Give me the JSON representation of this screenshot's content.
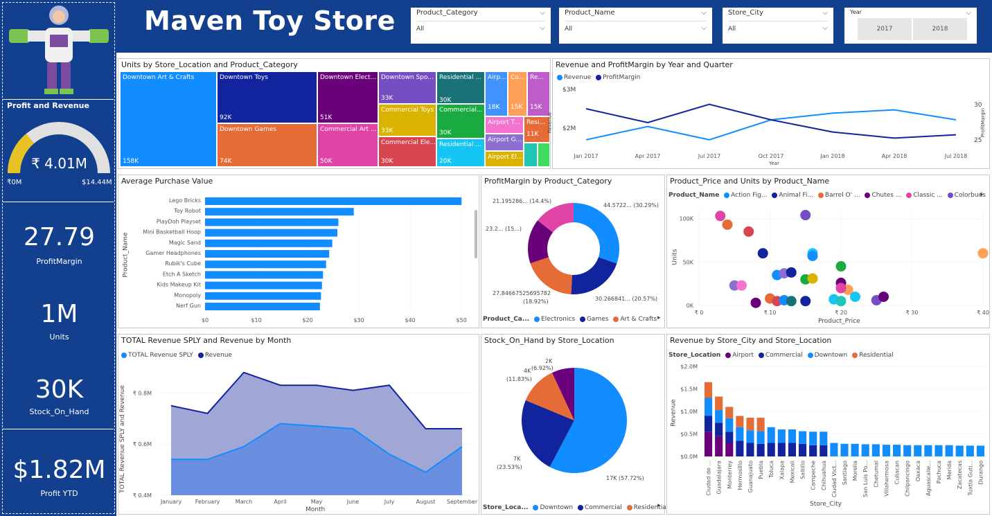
{
  "header": {
    "title": "Maven Toy Store"
  },
  "slicers": [
    {
      "label": "Product_Category",
      "value": "All"
    },
    {
      "label": "Product_Name",
      "value": "All"
    },
    {
      "label": "Store_City",
      "value": "All"
    }
  ],
  "year_slicer": {
    "label": "Year",
    "options": [
      "2017",
      "2018"
    ]
  },
  "left": {
    "gauge": {
      "title": "Profit and Revenue",
      "value": "₹ 4.01M",
      "min": "₹0M",
      "max": "$14.44M",
      "fraction": 0.28
    },
    "kpis": [
      {
        "value": "27.79",
        "label": "ProfitMargin"
      },
      {
        "value": "1M",
        "label": "Units"
      },
      {
        "value": "30K",
        "label": "Stock_On_Hand"
      },
      {
        "value": "$1.82M",
        "label": "Profit YTD"
      }
    ]
  },
  "colors": {
    "navy": "#133f8f",
    "blue": "#118dff",
    "darkblue": "#12239e",
    "orange": "#e66c37",
    "purple": "#6b007b",
    "pink": "#e044a7",
    "gold": "#e8c125"
  },
  "treemap": {
    "title": "Units by Store_Location and Product_Category",
    "cells": [
      {
        "label": "Downtown Art & Crafts",
        "value": "158K",
        "color": "#118dff"
      },
      {
        "label": "Downtown Toys",
        "value": "92K",
        "color": "#12239e"
      },
      {
        "label": "Downtown Games",
        "value": "74K",
        "color": "#e66c37"
      },
      {
        "label": "Downtown Elect...",
        "value": "51K",
        "color": "#6b007b"
      },
      {
        "label": "Commercial Art ...",
        "value": "50K",
        "color": "#e044a7"
      },
      {
        "label": "Downtown Spo...",
        "value": "33K",
        "color": "#744ec2"
      },
      {
        "label": "Commercial Toys",
        "value": "33K",
        "color": "#d9b300"
      },
      {
        "label": "Commercial Ele...",
        "value": "30K",
        "color": "#d64550"
      },
      {
        "label": "Residential ...",
        "value": "30K",
        "color": "#197278"
      },
      {
        "label": "Commercial...",
        "value": "30K",
        "color": "#1aab40"
      },
      {
        "label": "Residential ...",
        "value": "20K",
        "color": "#15c6f4"
      },
      {
        "label": "Airp...",
        "value": "18K",
        "color": "#4092ff"
      },
      {
        "label": "Co...",
        "value": "15K",
        "color": "#ffa058"
      },
      {
        "label": "Re...",
        "value": "15K",
        "color": "#be5dc9"
      },
      {
        "label": "Airport T...",
        "value": "",
        "color": "#f472d0"
      },
      {
        "label": "Resi...",
        "value": "11K",
        "color": "#e66c37"
      },
      {
        "label": "Airport G...",
        "value": "",
        "color": "#8d6fd1"
      },
      {
        "label": "Airport El...",
        "value": "",
        "color": "#d9b300"
      },
      {
        "label": "",
        "value": "",
        "color": "#1fc6b5"
      },
      {
        "label": "",
        "value": "",
        "color": "#3ddc5f"
      }
    ]
  },
  "line_chart": {
    "title": "Revenue and ProfitMargin by Year and Quarter",
    "legend": [
      "Revenue",
      "ProfitMargin"
    ],
    "ylabel_left": "Revenue",
    "ylabel_right": "ProfitMargin",
    "xlabel": "Year",
    "left_ticks": [
      "$3M",
      "$2M"
    ],
    "right_ticks": [
      "30",
      "25"
    ]
  },
  "bar_chart": {
    "title": "Average Purchase Value",
    "ylabel": "Product_Name",
    "x_ticks": [
      "$0",
      "$10",
      "$20",
      "$30",
      "$40",
      "$50"
    ]
  },
  "donut": {
    "title": "ProfitMargin by Product_Category",
    "labels": [
      "21.195286... (14.4%)",
      "44.5722... (30.29%)",
      "23.2... (15...)",
      "27.84667525695782",
      "(18.92%)",
      "30.266841... (20.57%)"
    ],
    "legend_title": "Product_Ca...",
    "legend": [
      "Electronics",
      "Games",
      "Art & Crafts"
    ]
  },
  "scatter": {
    "title": "Product_Price and Units by Product_Name",
    "legend_title": "Product_Name",
    "legend": [
      "Action Fig...",
      "Animal Fi...",
      "Barrel O' ...",
      "Chutes ...",
      "Classic ...",
      "Colorbuds"
    ],
    "xlabel": "Product_Price",
    "ylabel": "Units",
    "x_ticks": [
      "₹ 0",
      "₹ 10",
      "₹ 20",
      "₹ 30",
      "₹ 40"
    ],
    "y_ticks": [
      "100K",
      "50K",
      "0K"
    ]
  },
  "area_chart": {
    "title": "TOTAL Revenue SPLY and Revenue by Month",
    "legend": [
      "TOTAL Revenue SPLY",
      "Revenue"
    ],
    "ylabel": "TOTAL Revenue SPLY and Revenue",
    "xlabel": "Month",
    "y_ticks": [
      "₹ 0.8M",
      "₹ 0.6M",
      "₹ 0.4M"
    ]
  },
  "pie": {
    "title": "Stock_On_Hand by Store_Location",
    "labels": [
      "2K",
      "(6.92%)",
      "4K",
      "(11.83%)",
      "7K",
      "(23.53%)",
      "17K (57.72%)"
    ],
    "legend_title": "Store_Loca...",
    "legend": [
      "Downtown",
      "Commercial",
      "Residential"
    ]
  },
  "stacked": {
    "title": "Revenue by Store_City and Store_Location",
    "legend_title": "Store_Location",
    "legend": [
      "Airport",
      "Commercial",
      "Downtown",
      "Residential"
    ],
    "ylabel": "Revenue",
    "xlabel": "Store_City",
    "y_ticks": [
      "$2.0M",
      "$1.5M",
      "$1.0M",
      "$0.5M",
      "$0.0M"
    ]
  },
  "chart_data": [
    {
      "type": "line",
      "title": "Revenue and ProfitMargin by Year and Quarter",
      "x": [
        "Jan 2017",
        "Apr 2017",
        "Jul 2017",
        "Oct 2017",
        "Jan 2018",
        "Apr 2018",
        "Jul 2018"
      ],
      "series": [
        {
          "name": "Revenue",
          "values": [
            1.6,
            2.0,
            1.6,
            2.2,
            2.4,
            2.5,
            2.2
          ],
          "axis": "left",
          "ylim": [
            1.2,
            3.2
          ]
        },
        {
          "name": "ProfitMargin",
          "values": [
            30.0,
            27.5,
            30.8,
            28.0,
            25.8,
            24.7,
            25.3
          ],
          "axis": "right",
          "ylim": [
            22,
            34
          ]
        }
      ]
    },
    {
      "type": "bar",
      "title": "Average Purchase Value",
      "orientation": "horizontal",
      "categories": [
        "Lego Bricks",
        "Toy Robot",
        "PlayDoh Playset",
        "Mini Basketball Hoop",
        "Magic Sand",
        "Gamer Headphones",
        "Rubik's Cube",
        "Etch A Sketch",
        "Kids Makeup Kit",
        "Monopoly",
        "Nerf Gun"
      ],
      "values": [
        50.0,
        29.0,
        26.0,
        25.8,
        24.8,
        24.2,
        23.6,
        23.0,
        22.8,
        22.6,
        22.4
      ],
      "xlim": [
        0,
        52
      ]
    },
    {
      "type": "pie",
      "title": "ProfitMargin by Product_Category",
      "hole": true,
      "slices": [
        {
          "label": "Electronics",
          "percent": 30.29,
          "color": "#118dff"
        },
        {
          "label": "Games",
          "percent": 20.57,
          "color": "#12239e"
        },
        {
          "label": "Art & Crafts",
          "percent": 18.92,
          "color": "#e66c37"
        },
        {
          "label": "",
          "percent": 15.82,
          "color": "#6b007b"
        },
        {
          "label": "",
          "percent": 14.4,
          "color": "#e044a7"
        }
      ]
    },
    {
      "type": "scatter",
      "title": "Product_Price and Units by Product_Name",
      "xlim": [
        0,
        40
      ],
      "ylim": [
        0,
        110
      ],
      "points": [
        {
          "x": 3,
          "y": 103,
          "c": "#e044a7"
        },
        {
          "x": 4,
          "y": 93,
          "c": "#e66c37"
        },
        {
          "x": 7,
          "y": 85,
          "c": "#d64550"
        },
        {
          "x": 9,
          "y": 60,
          "c": "#12239e"
        },
        {
          "x": 15,
          "y": 104,
          "c": "#744ec2"
        },
        {
          "x": 16,
          "y": 60,
          "c": "#15c6f4"
        },
        {
          "x": 16,
          "y": 57,
          "c": "#118dff"
        },
        {
          "x": 20,
          "y": 45,
          "c": "#1aab40"
        },
        {
          "x": 5,
          "y": 23,
          "c": "#8d6fd1"
        },
        {
          "x": 6,
          "y": 23,
          "c": "#f472d0"
        },
        {
          "x": 11,
          "y": 35,
          "c": "#118dff"
        },
        {
          "x": 12,
          "y": 37,
          "c": "#8d6fd1"
        },
        {
          "x": 13,
          "y": 38,
          "c": "#12239e"
        },
        {
          "x": 15,
          "y": 30,
          "c": "#1aab40"
        },
        {
          "x": 16,
          "y": 31,
          "c": "#d9b300"
        },
        {
          "x": 20,
          "y": 26,
          "c": "#6b007b"
        },
        {
          "x": 21,
          "y": 18,
          "c": "#ffa058"
        },
        {
          "x": 20,
          "y": 20,
          "c": "#e044a7"
        },
        {
          "x": 8,
          "y": 3,
          "c": "#6b007b"
        },
        {
          "x": 10,
          "y": 8,
          "c": "#e66c37"
        },
        {
          "x": 11,
          "y": 5,
          "c": "#d64550"
        },
        {
          "x": 12,
          "y": 6,
          "c": "#118dff"
        },
        {
          "x": 13,
          "y": 5,
          "c": "#197278"
        },
        {
          "x": 15,
          "y": 5,
          "c": "#12239e"
        },
        {
          "x": 19,
          "y": 7,
          "c": "#15c6f4"
        },
        {
          "x": 20,
          "y": 5,
          "c": "#1fc6b5"
        },
        {
          "x": 22,
          "y": 10,
          "c": "#15c6f4"
        },
        {
          "x": 25,
          "y": 6,
          "c": "#744ec2"
        },
        {
          "x": 26,
          "y": 10,
          "c": "#6b007b"
        },
        {
          "x": 40,
          "y": 60,
          "c": "#ffa058"
        }
      ]
    },
    {
      "type": "area",
      "title": "TOTAL Revenue SPLY and Revenue by Month",
      "categories": [
        "January",
        "February",
        "March",
        "April",
        "May",
        "June",
        "July",
        "August",
        "September"
      ],
      "series": [
        {
          "name": "TOTAL Revenue SPLY",
          "values": [
            0.54,
            0.54,
            0.59,
            0.68,
            0.67,
            0.66,
            0.56,
            0.49,
            0.59
          ]
        },
        {
          "name": "Revenue",
          "values": [
            0.75,
            0.72,
            0.88,
            0.83,
            0.83,
            0.81,
            0.83,
            0.66,
            0.66
          ]
        }
      ],
      "ylim": [
        0.4,
        0.92
      ]
    },
    {
      "type": "pie",
      "title": "Stock_On_Hand by Store_Location",
      "slices": [
        {
          "label": "Downtown",
          "value": 17,
          "percent": 57.72,
          "color": "#118dff"
        },
        {
          "label": "Commercial",
          "value": 7,
          "percent": 23.53,
          "color": "#12239e"
        },
        {
          "label": "Residential",
          "value": 4,
          "percent": 11.83,
          "color": "#e66c37"
        },
        {
          "label": "Airport",
          "value": 2,
          "percent": 6.92,
          "color": "#6b007b"
        }
      ]
    },
    {
      "type": "bar",
      "stacked": true,
      "title": "Revenue by Store_City and Store_Location",
      "ylim": [
        0,
        2.0
      ],
      "categories": [
        "Ciudad de ...",
        "Guadalajara",
        "Monterrey",
        "Hermosillo",
        "Guanajuato",
        "Puebla",
        "Toluca",
        "Xalapa",
        "Mexicali",
        "Saltillo",
        "Campeche",
        "Chihuahua",
        "Ciudad Vict...",
        "Santiago",
        "Morelia",
        "San Luis Po...",
        "Chetumal",
        "Villahermosa",
        "Culiacan",
        "Chilpancingo",
        "Oaxaca",
        "Aguascalie...",
        "Pachuca",
        "Merida",
        "Zacatecas",
        "Tuxtla Guti...",
        "Durango"
      ],
      "series": [
        {
          "name": "Airport",
          "color": "#6b007b",
          "values": [
            0.55,
            0.45,
            0.3,
            0,
            0,
            0,
            0,
            0,
            0,
            0,
            0,
            0,
            0,
            0,
            0,
            0,
            0,
            0,
            0,
            0,
            0,
            0,
            0,
            0,
            0,
            0,
            0
          ]
        },
        {
          "name": "Commercial",
          "color": "#12239e",
          "values": [
            0.35,
            0.3,
            0.25,
            0.35,
            0.3,
            0.28,
            0.3,
            0.3,
            0.3,
            0.28,
            0.25,
            0.25,
            0,
            0,
            0,
            0,
            0,
            0,
            0,
            0,
            0,
            0,
            0,
            0,
            0,
            0,
            0
          ]
        },
        {
          "name": "Downtown",
          "color": "#118dff",
          "values": [
            0.4,
            0.28,
            0.3,
            0.3,
            0.28,
            0.28,
            0.35,
            0.3,
            0.3,
            0.28,
            0.3,
            0.3,
            0.3,
            0.28,
            0.28,
            0.27,
            0.27,
            0.26,
            0.26,
            0.25,
            0.25,
            0.25,
            0.25,
            0.25,
            0.24,
            0.24,
            0.24
          ]
        },
        {
          "name": "Residential",
          "color": "#e66c37",
          "values": [
            0.35,
            0.3,
            0.25,
            0.25,
            0.28,
            0.3,
            0,
            0,
            0,
            0,
            0,
            0,
            0,
            0,
            0,
            0,
            0,
            0,
            0,
            0,
            0,
            0,
            0,
            0,
            0,
            0,
            0
          ]
        }
      ]
    }
  ]
}
